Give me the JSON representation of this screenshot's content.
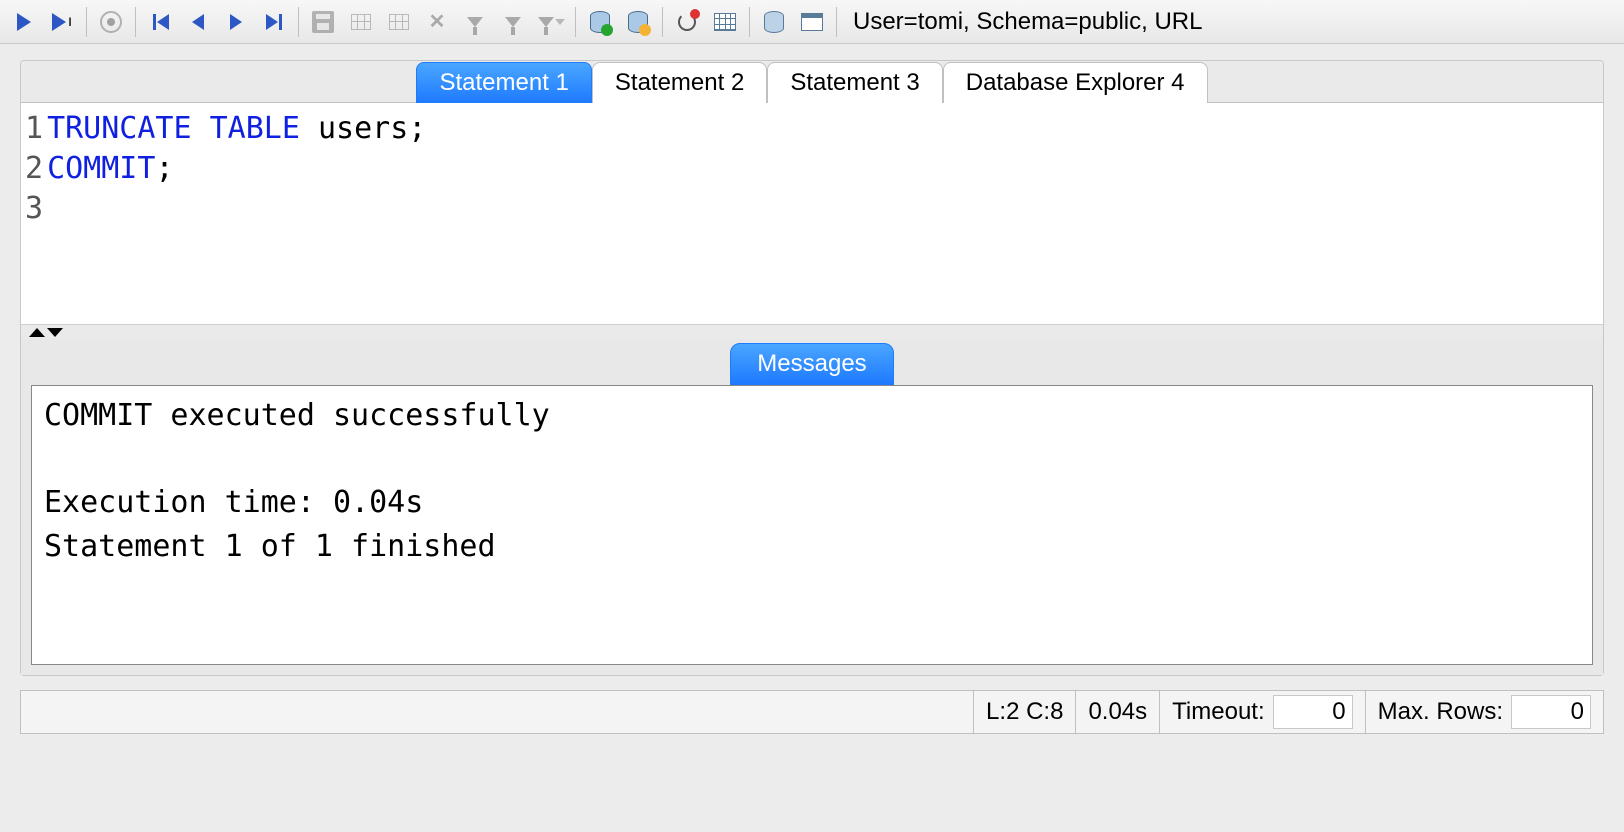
{
  "toolbar": {
    "connection_status": "User=tomi, Schema=public, URL"
  },
  "tabs": [
    {
      "label": "Statement 1",
      "active": true
    },
    {
      "label": "Statement 2",
      "active": false
    },
    {
      "label": "Statement 3",
      "active": false
    },
    {
      "label": "Database Explorer 4",
      "active": false
    }
  ],
  "editor": {
    "lines": [
      {
        "n": "1",
        "kw": "TRUNCATE TABLE",
        "rest": " users;"
      },
      {
        "n": "2",
        "kw": "COMMIT",
        "rest": ";"
      },
      {
        "n": "3",
        "kw": "",
        "rest": ""
      }
    ]
  },
  "messages": {
    "tab_label": "Messages",
    "text": "COMMIT executed successfully\n\nExecution time: 0.04s\nStatement 1 of 1 finished"
  },
  "statusbar": {
    "cursor": "L:2 C:8",
    "exec_time": "0.04s",
    "timeout_label": "Timeout:",
    "timeout_value": "0",
    "maxrows_label": "Max. Rows:",
    "maxrows_value": "0"
  }
}
